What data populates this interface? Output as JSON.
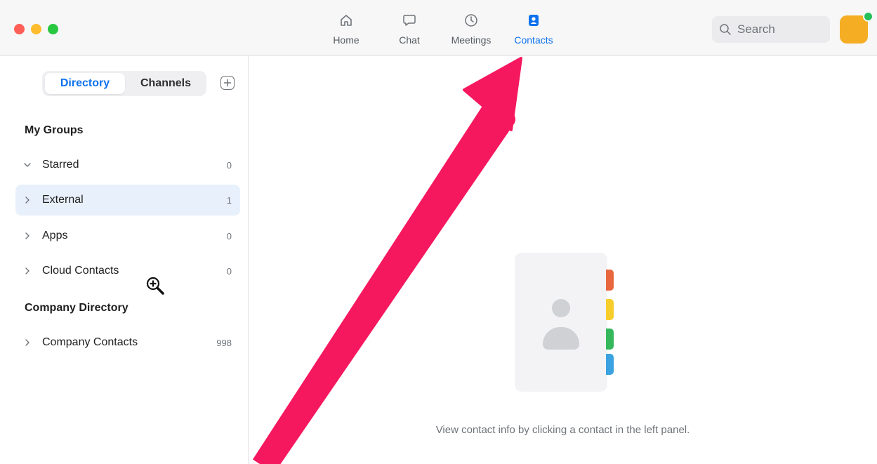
{
  "nav": {
    "home": "Home",
    "chat": "Chat",
    "meetings": "Meetings",
    "contacts": "Contacts",
    "active": "contacts"
  },
  "search": {
    "placeholder": "Search"
  },
  "sidebar": {
    "tabs": {
      "directory": "Directory",
      "channels": "Channels",
      "active": "directory"
    },
    "my_groups": {
      "title": "My Groups",
      "items": [
        {
          "name": "Starred",
          "count": "0",
          "expanded": true
        },
        {
          "name": "External",
          "count": "1",
          "selected": true
        },
        {
          "name": "Apps",
          "count": "0"
        },
        {
          "name": "Cloud Contacts",
          "count": "0"
        }
      ]
    },
    "company_directory": {
      "title": "Company Directory",
      "items": [
        {
          "name": "Company Contacts",
          "count": "998"
        }
      ]
    }
  },
  "main": {
    "empty_hint": "View contact info by clicking a contact in the left panel."
  },
  "colors": {
    "accent": "#0e72ed",
    "annotation_arrow": "#f5185f",
    "avatar": "#f5ad24",
    "presence": "#25c05a"
  },
  "icons": [
    "home-icon",
    "chat-icon",
    "clock-icon",
    "contacts-icon",
    "search-icon",
    "plus-icon",
    "chevron-down-icon",
    "chevron-right-icon",
    "zoom-cursor-icon",
    "address-book-illustration"
  ]
}
